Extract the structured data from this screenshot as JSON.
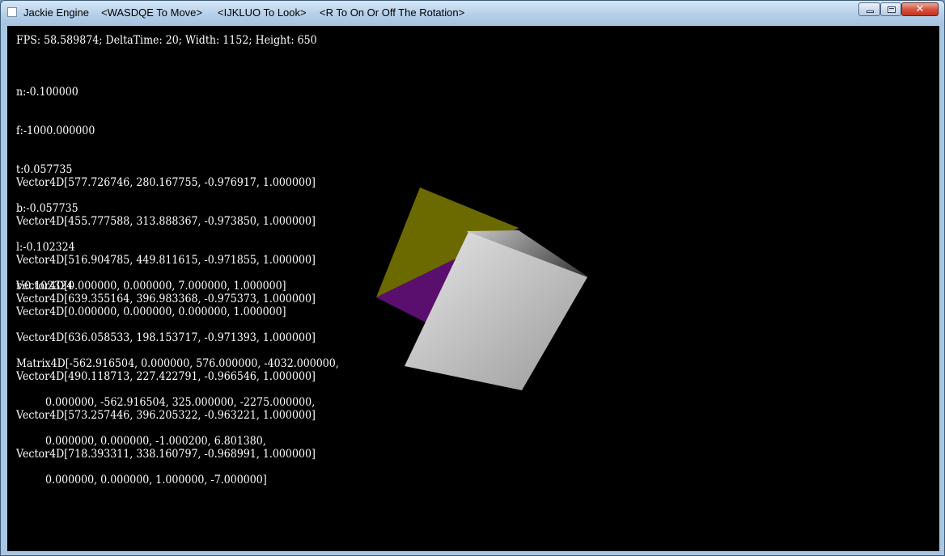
{
  "window": {
    "title_parts": [
      "Jackie Engine",
      "<WASDQE To Move>",
      "<IJKLUO To Look>",
      "<R To On Or Off The Rotation>"
    ],
    "close_glyph": "✕"
  },
  "hud": {
    "stats_line": "FPS: 58.589874; DeltaTime: 20; Width: 1152; Height: 650",
    "frustum": [
      "n:-0.100000",
      "f:-1000.000000",
      "t:0.057735",
      "b:-0.057735",
      "l:-0.102324",
      "r:0.102324"
    ],
    "vertices": [
      "Vector4D[577.726746, 280.167755, -0.976917, 1.000000]",
      "Vector4D[455.777588, 313.888367, -0.973850, 1.000000]",
      "Vector4D[516.904785, 449.811615, -0.971855, 1.000000]",
      "Vector4D[639.355164, 396.983368, -0.975373, 1.000000]",
      "Vector4D[636.058533, 198.153717, -0.971393, 1.000000]",
      "Vector4D[490.118713, 227.422791, -0.966546, 1.000000]",
      "Vector4D[573.257446, 396.205322, -0.963221, 1.000000]",
      "Vector4D[718.393311, 338.160797, -0.968991, 1.000000]"
    ],
    "vector_a": "Vector4D[0.000000, 0.000000, 7.000000, 1.000000]",
    "vector_b": "Vector4D[0.000000, 0.000000, 0.000000, 1.000000]",
    "matrix": [
      "Matrix4D[-562.916504, 0.000000, 576.000000, -4032.000000,",
      "         0.000000, -562.916504, 325.000000, -2275.000000,",
      "         0.000000, 0.000000, -1.000200, 6.801380,",
      "         0.000000, 0.000000, 1.000000, -7.000000]"
    ]
  },
  "scene": {
    "colors": {
      "yellow_face": "#6b6a00",
      "purple_face": "#5a0f6e",
      "front_face_light": "#e6e6e6",
      "front_face_dark": "#9a9a9a",
      "side_face_light": "#c8c8c8",
      "side_face_dark": "#3a3a3a"
    }
  }
}
